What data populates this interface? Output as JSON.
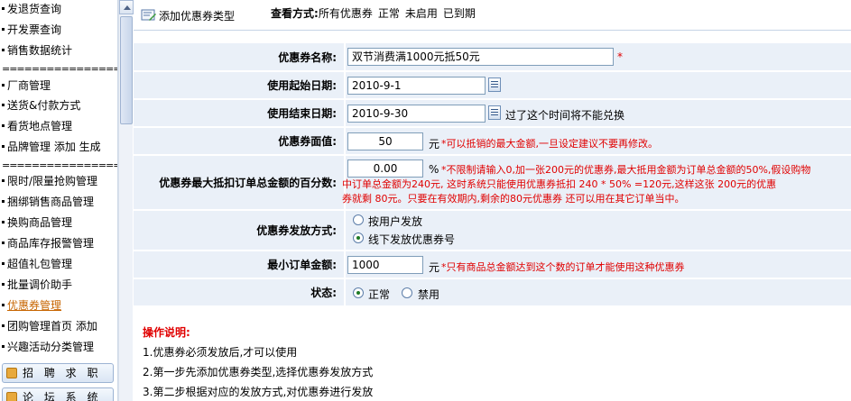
{
  "sidebar": {
    "items_top": [
      {
        "label": "发退货查询"
      },
      {
        "label": "开发票查询"
      },
      {
        "label": "销售数据统计"
      }
    ],
    "separator": "===================",
    "items_mid": [
      {
        "label": "厂商管理"
      },
      {
        "label": "送货&付款方式"
      },
      {
        "label": "看货地点管理"
      },
      {
        "label": "品牌管理 添加 生成"
      }
    ],
    "items_bottom": [
      {
        "label": "限时/限量抢购管理"
      },
      {
        "label": "捆绑销售商品管理"
      },
      {
        "label": "换购商品管理"
      },
      {
        "label": "商品库存报警管理"
      },
      {
        "label": "超值礼包管理"
      },
      {
        "label": "批量调价助手"
      },
      {
        "label": "优惠券管理"
      },
      {
        "label": "团购管理首页 添加"
      },
      {
        "label": "兴趣活动分类管理"
      }
    ],
    "buttons": [
      {
        "label": "招 聘 求 职"
      },
      {
        "label": "论 坛 系 统"
      }
    ]
  },
  "topbar": {
    "add_label": "添加优惠券类型",
    "view_prefix": "查看方式:",
    "view_options": [
      "所有优惠券",
      "正常",
      "未启用",
      "已到期"
    ]
  },
  "form": {
    "name": {
      "label": "优惠券名称:",
      "value": "双节消费满1000元抵50元",
      "required": "*"
    },
    "start_date": {
      "label": "使用起始日期:",
      "value": "2010-9-1"
    },
    "end_date": {
      "label": "使用结束日期:",
      "value": "2010-9-30",
      "hint": "过了这个时间将不能兑换"
    },
    "face_value": {
      "label": "优惠券面值:",
      "value": "50",
      "unit": "元",
      "hint": "*可以抵销的最大金额,一旦设定建议不要再修改。"
    },
    "max_percent": {
      "label": "优惠券最大抵扣订单总金额的百分数:",
      "value": "0.00",
      "unit": "%",
      "hint_line1": "*不限制请输入0,加一张200元的优惠券,最大抵用金额为订单总金额的50%,假设购物",
      "hint_line2": "中订单总金额为240元,  这时系统只能使用优惠券抵扣 240 * 50% =120元,这样这张 200元的优惠",
      "hint_line3": "券就剩 80元。只要在有效期内,剩余的80元优惠券 还可以用在其它订单当中。"
    },
    "issue_method": {
      "label": "优惠券发放方式:",
      "options": [
        "按用户发放",
        "线下发放优惠券号"
      ],
      "selected_index": 1
    },
    "min_order": {
      "label": "最小订单金额:",
      "value": "1000",
      "unit": "元",
      "hint": "*只有商品总金额达到这个数的订单才能使用这种优惠券"
    },
    "status": {
      "label": "状态:",
      "options": [
        "正常",
        "禁用"
      ],
      "selected_index": 0
    }
  },
  "instructions": {
    "title": "操作说明:",
    "lines": [
      "1.优惠券必须发放后,才可以使用",
      "2.第一步先添加优惠券类型,选择优惠券发放方式",
      "3.第二步根据对应的发放方式,对优惠券进行发放"
    ]
  }
}
